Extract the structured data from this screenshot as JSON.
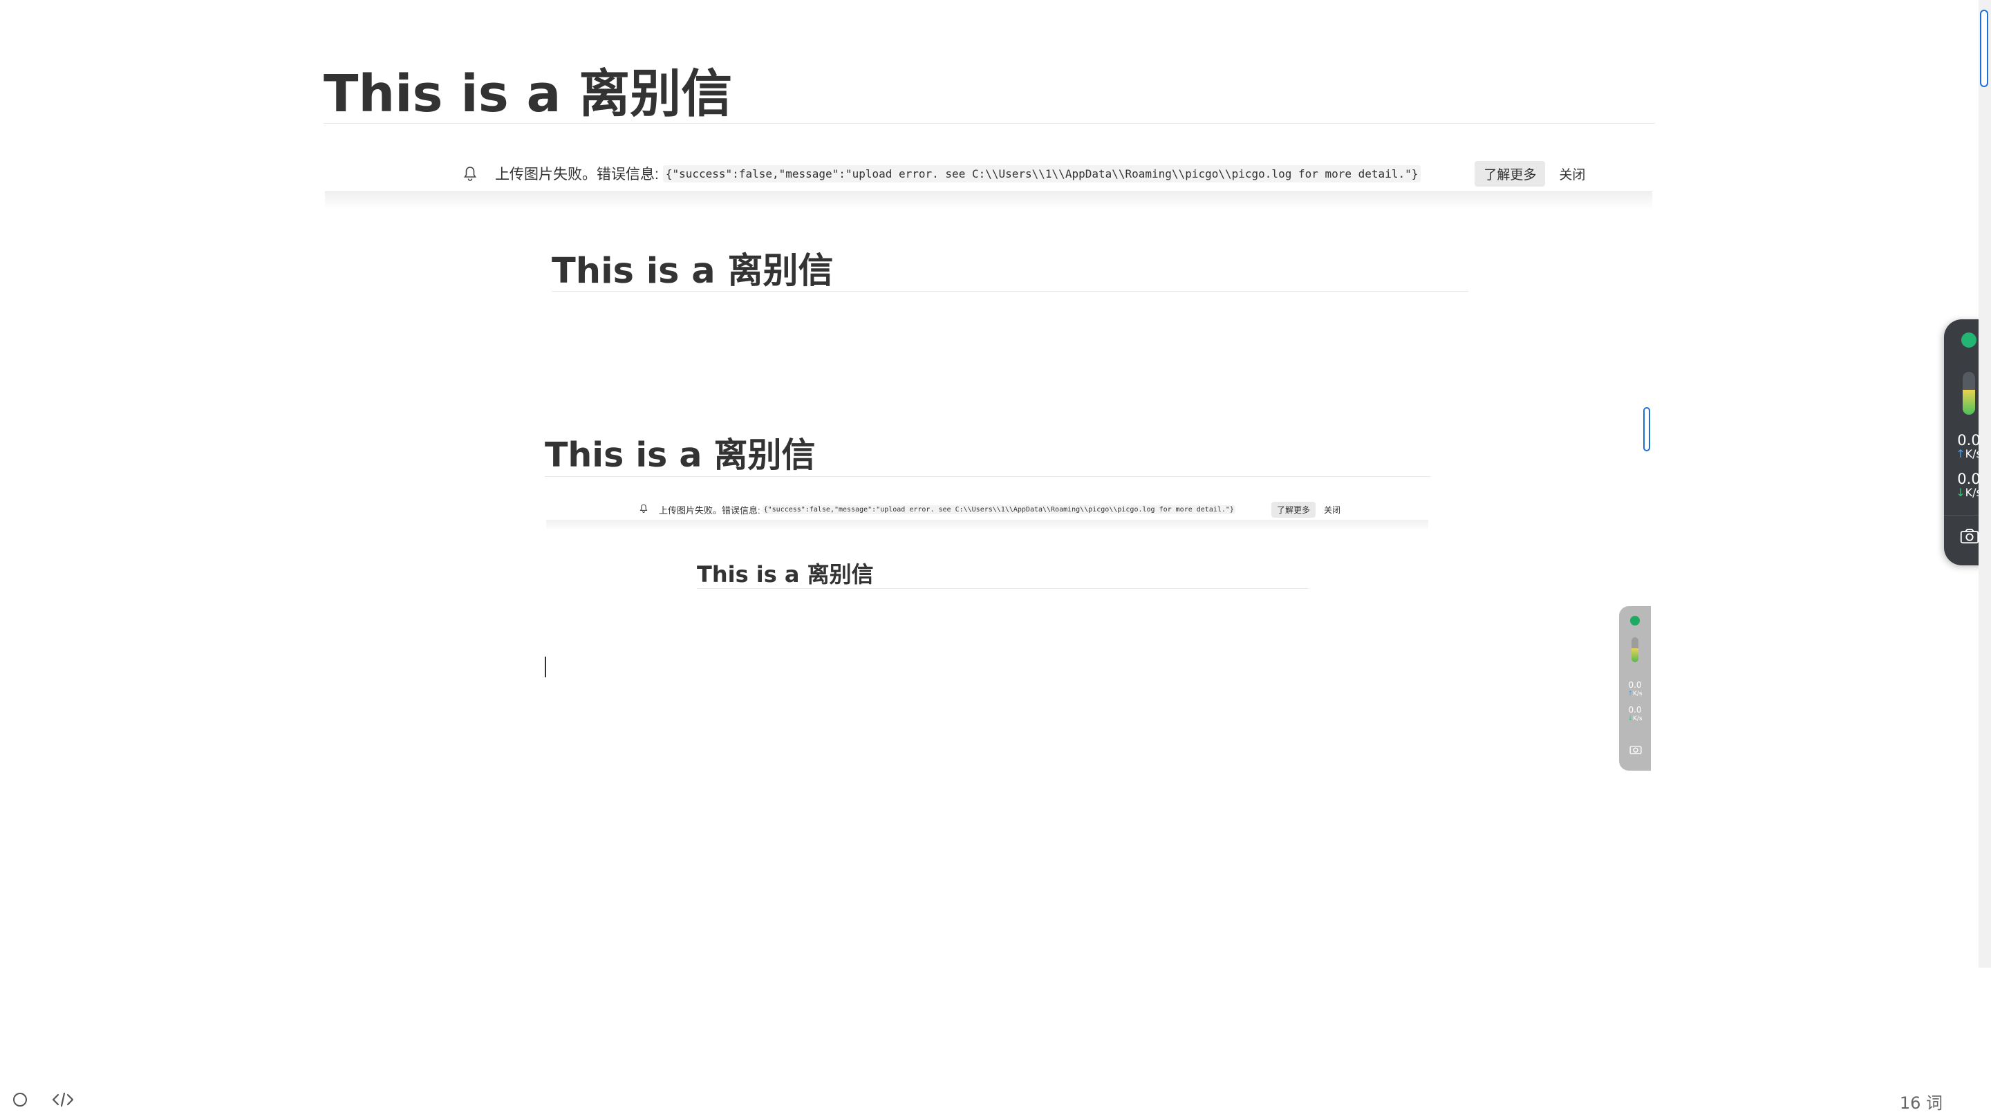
{
  "document": {
    "heading": "This is a 离别信"
  },
  "notification": {
    "message": "上传图片失败。错误信息:",
    "error_detail": "{\"success\":false,\"message\":\"upload error. see C:\\\\Users\\\\1\\\\AppData\\\\Roaming\\\\picgo\\\\picgo.log for more detail.\"}",
    "learn_more_label": "了解更多",
    "close_label": "关闭"
  },
  "nested_preview": {
    "heading": "This is a 离别信",
    "inner_heading": "This is a 离别信",
    "deep_heading": "This is a 离别信"
  },
  "network_widget": {
    "upload_value": "0.0",
    "upload_unit": "K/s",
    "download_value": "0.0",
    "download_unit": "K/s",
    "status_color": "#22b573",
    "upload_arrow_color": "#3ea6ff",
    "download_arrow_color": "#2ecc71"
  },
  "status_bar": {
    "word_count": "16 词",
    "icons": [
      "circle-icon",
      "source-code-icon"
    ]
  }
}
